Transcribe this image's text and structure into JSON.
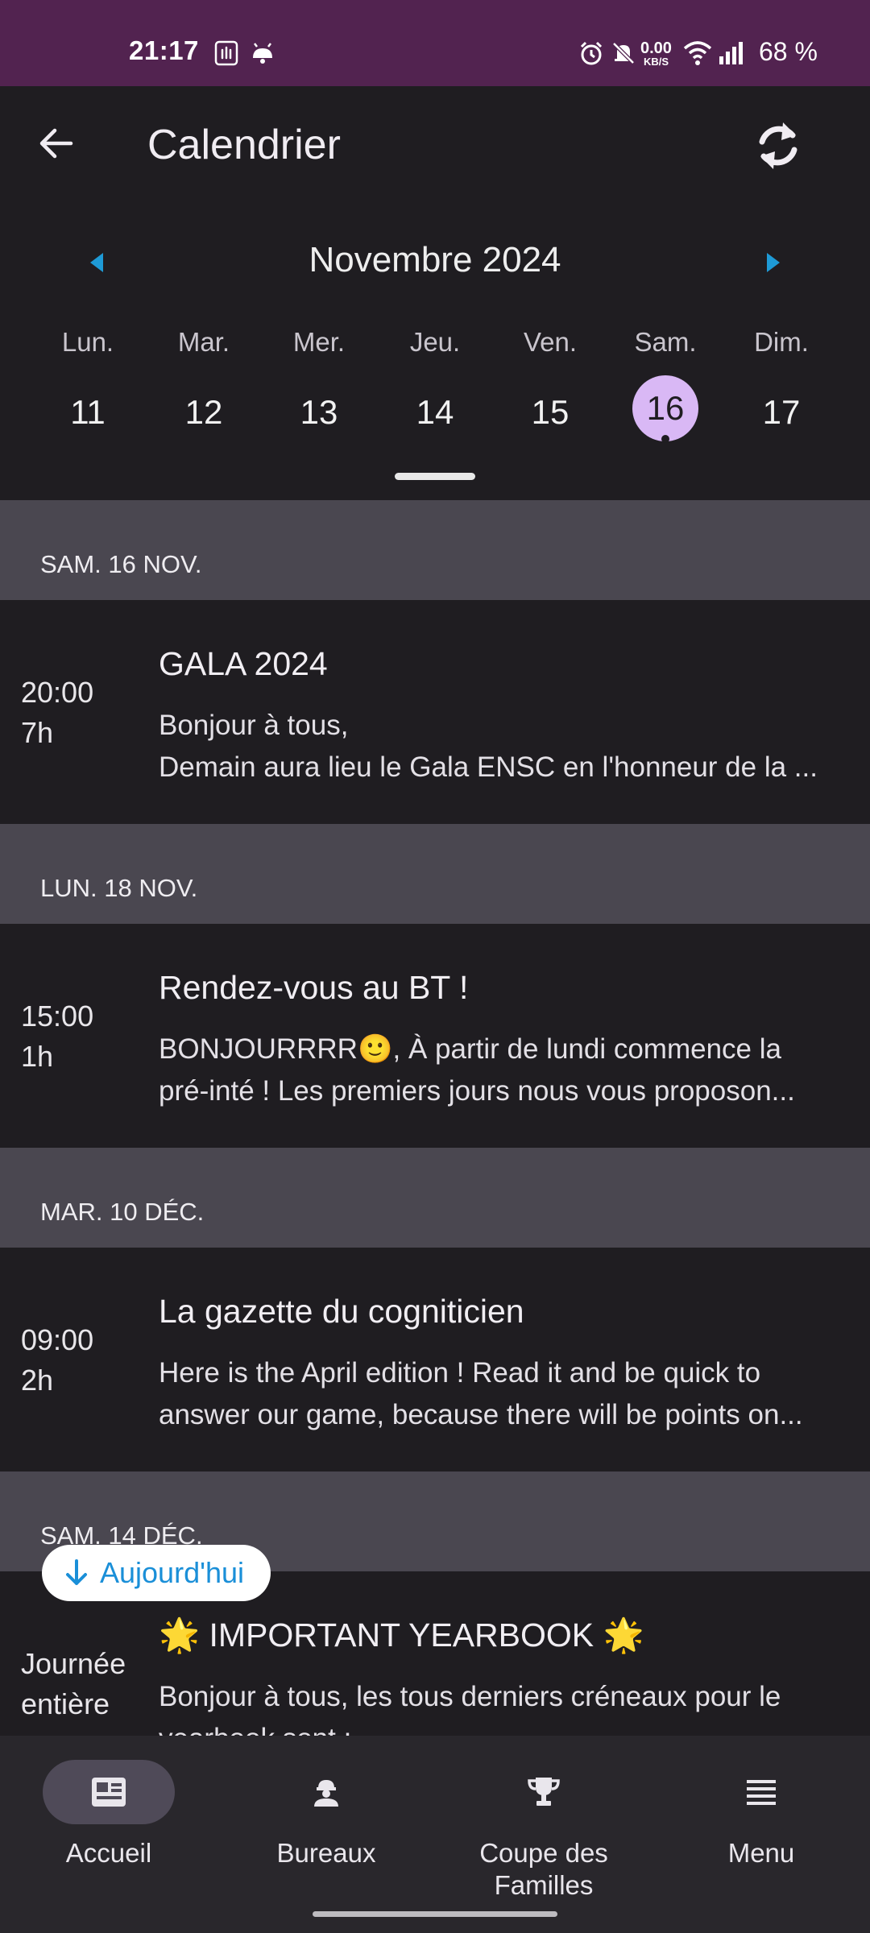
{
  "status_bar": {
    "time": "21:17",
    "net_speed_value": "0.00",
    "net_speed_unit": "KB/S",
    "battery": "68 %",
    "icons": [
      "nfc-icon",
      "android-icon",
      "alarm-icon",
      "mute-icon",
      "wifi-icon",
      "signal-icon"
    ]
  },
  "header": {
    "title": "Calendrier",
    "back_icon": "arrow-left-icon",
    "refresh_icon": "sync-icon"
  },
  "calendar": {
    "month_label": "Novembre 2024",
    "days": [
      {
        "name": "Lun.",
        "num": "11"
      },
      {
        "name": "Mar.",
        "num": "12"
      },
      {
        "name": "Mer.",
        "num": "13"
      },
      {
        "name": "Jeu.",
        "num": "14"
      },
      {
        "name": "Ven.",
        "num": "15"
      },
      {
        "name": "Sam.",
        "num": "16"
      },
      {
        "name": "Dim.",
        "num": "17"
      }
    ],
    "selected_day": "16"
  },
  "agenda": [
    {
      "date_header": "SAM. 16 NOV.",
      "time": "20:00",
      "duration": "7h",
      "title": "GALA 2024",
      "desc_line1": "Bonjour à tous,",
      "desc_line2": "Demain aura lieu le Gala ENSC en l'honneur de la ..."
    },
    {
      "date_header": "LUN. 18 NOV.",
      "time": "15:00",
      "duration": "1h",
      "title": "Rendez-vous au BT !",
      "desc_line1": "BONJOURRRR🙂, À partir de lundi commence la",
      "desc_line2": "pré-inté !  Les premiers jours nous vous proposon..."
    },
    {
      "date_header": "MAR. 10 DÉC.",
      "time": "09:00",
      "duration": "2h",
      "title": "La gazette du cogniticien",
      "desc_line1": "Here is the April edition ! Read it and be quick to",
      "desc_line2": "answer our game, because there will be points on..."
    },
    {
      "date_header": "SAM. 14 DÉC.",
      "time": "Journée",
      "duration": "entière",
      "title": "🌟 IMPORTANT YEARBOOK 🌟",
      "desc_line1": "Bonjour à tous,  les tous derniers créneaux pour le",
      "desc_line2": "yearbook sont :"
    }
  ],
  "today_button": {
    "label": "Aujourd'hui"
  },
  "bottom_nav": [
    {
      "label": "Accueil",
      "icon": "newspaper-icon",
      "active": true
    },
    {
      "label": "Bureaux",
      "icon": "worker-icon",
      "active": false
    },
    {
      "label": "Coupe des Familles",
      "icon": "trophy-icon",
      "active": false
    },
    {
      "label": "Menu",
      "icon": "menu-lines-icon",
      "active": false
    }
  ],
  "colors": {
    "status_bar": "#522350",
    "background": "#1f1d21",
    "section_header": "#4a4750",
    "selected_day": "#d9b8f5",
    "accent_arrow": "#1e9ad6",
    "nav_active_pill": "#4f4a58"
  }
}
